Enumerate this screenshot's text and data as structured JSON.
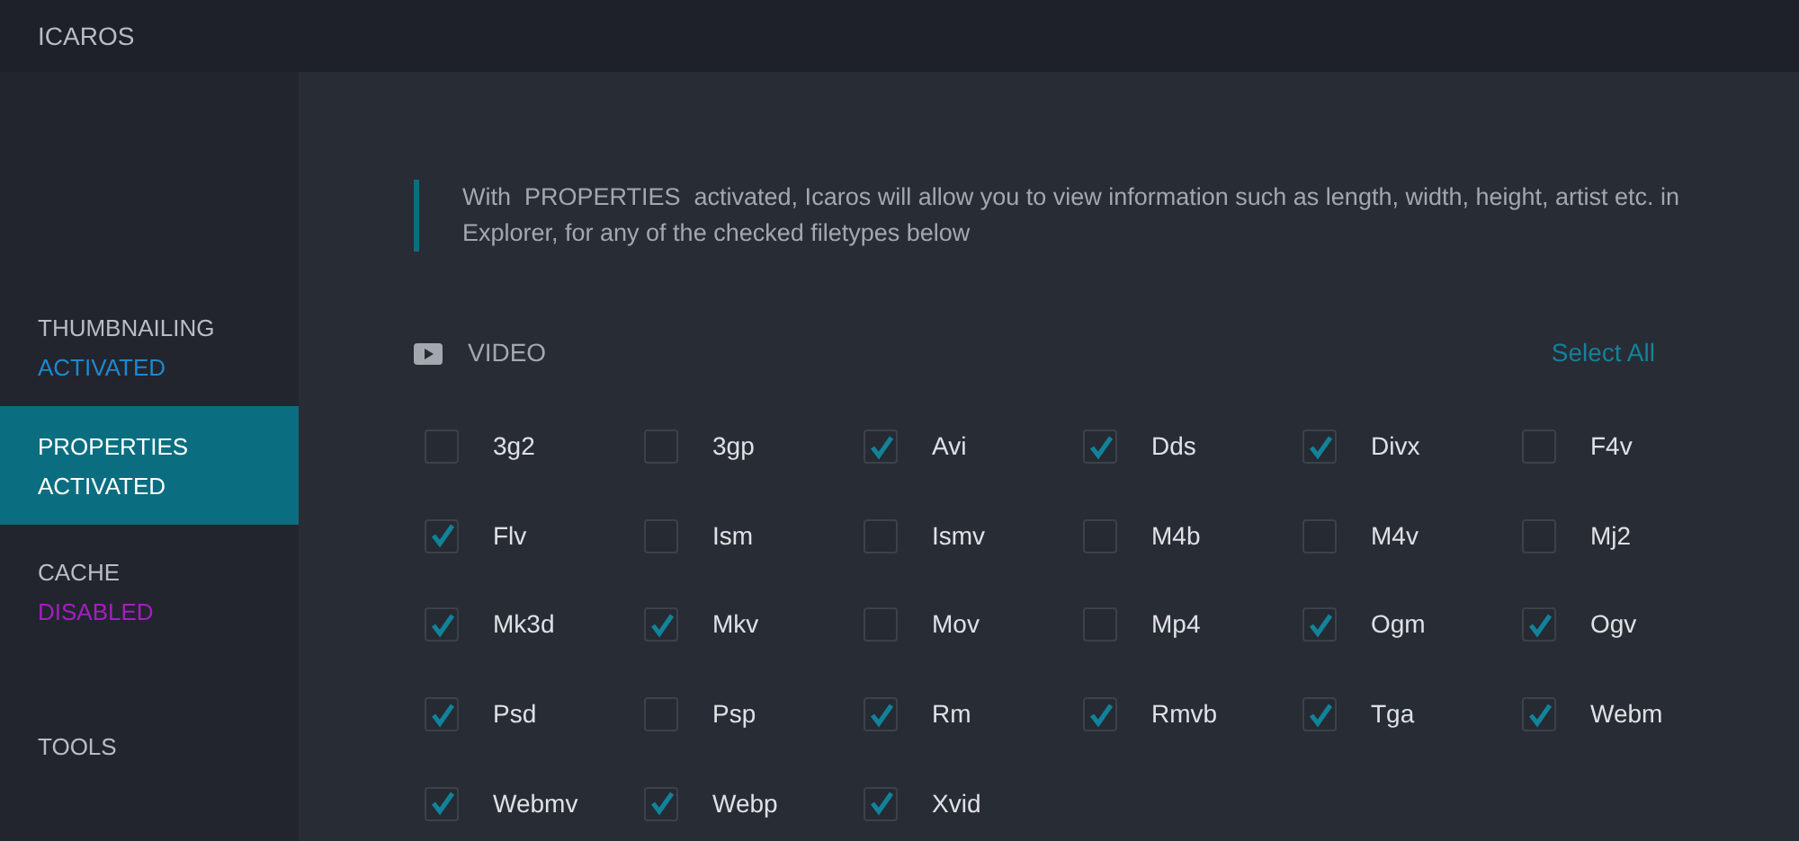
{
  "app_title": "ICAROS",
  "sidebar": {
    "items": [
      {
        "label": "THUMBNAILING",
        "status": {
          "text": "ACTIVATED",
          "kind": "activated"
        },
        "selected": false
      },
      {
        "label": "PROPERTIES",
        "status": {
          "text": "ACTIVATED",
          "kind": "activated"
        },
        "selected": true
      },
      {
        "label": "CACHE",
        "status": {
          "text": "DISABLED",
          "kind": "disabled"
        },
        "selected": false
      },
      {
        "label": "TOOLS",
        "selected": false
      }
    ]
  },
  "description": "With  PROPERTIES  activated, Icaros will allow you to view information such as length, width, height, artist etc. in Explorer, for any of the checked filetypes below",
  "section": {
    "title": "VIDEO",
    "select_all": "Select All",
    "filetypes": [
      {
        "label": "3g2",
        "checked": false
      },
      {
        "label": "3gp",
        "checked": false
      },
      {
        "label": "Avi",
        "checked": true
      },
      {
        "label": "Dds",
        "checked": true
      },
      {
        "label": "Divx",
        "checked": true
      },
      {
        "label": "F4v",
        "checked": false
      },
      {
        "label": "Flv",
        "checked": true
      },
      {
        "label": "Ism",
        "checked": false
      },
      {
        "label": "Ismv",
        "checked": false
      },
      {
        "label": "M4b",
        "checked": false
      },
      {
        "label": "M4v",
        "checked": false
      },
      {
        "label": "Mj2",
        "checked": false
      },
      {
        "label": "Mk3d",
        "checked": true
      },
      {
        "label": "Mkv",
        "checked": true
      },
      {
        "label": "Mov",
        "checked": false
      },
      {
        "label": "Mp4",
        "checked": false
      },
      {
        "label": "Ogm",
        "checked": true
      },
      {
        "label": "Ogv",
        "checked": true
      },
      {
        "label": "Psd",
        "checked": true
      },
      {
        "label": "Psp",
        "checked": false
      },
      {
        "label": "Rm",
        "checked": true
      },
      {
        "label": "Rmvb",
        "checked": true
      },
      {
        "label": "Tga",
        "checked": true
      },
      {
        "label": "Webm",
        "checked": true
      },
      {
        "label": "Webmv",
        "checked": true
      },
      {
        "label": "Webp",
        "checked": true
      },
      {
        "label": "Xvid",
        "checked": true
      }
    ]
  }
}
